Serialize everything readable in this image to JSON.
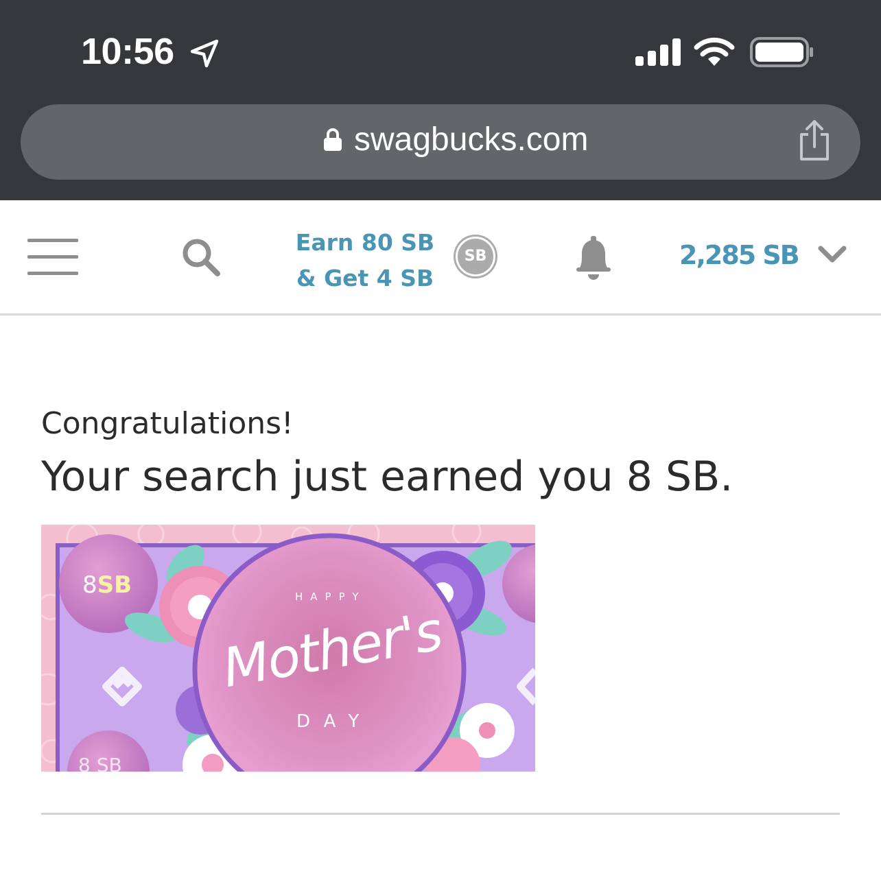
{
  "status_bar": {
    "time": "10:56",
    "icons": [
      "location-arrow-icon",
      "cellular-signal-icon",
      "wifi-icon",
      "battery-icon"
    ]
  },
  "browser": {
    "url": "swagbucks.com",
    "icons": [
      "lock-icon",
      "share-icon"
    ]
  },
  "header": {
    "earn_line1": "Earn 80 SB",
    "earn_line2": "& Get 4 SB",
    "coin_label": "SB",
    "balance": "2,285 SB",
    "accent_color": "#4a95b4",
    "icons": [
      "menu-icon",
      "search-icon",
      "bell-icon",
      "chevron-down-icon"
    ]
  },
  "main": {
    "congrats": "Congratulations!",
    "message": "Your search just earned you 8 SB."
  },
  "banner": {
    "sb_top_number": "8",
    "sb_top_unit": "SB",
    "sb_bottom": "8 SB",
    "happy": "HAPPY",
    "script": "Mother's",
    "day": "DAY",
    "background_color": "#c9a8ee",
    "circle_color": "#d98cbf"
  }
}
